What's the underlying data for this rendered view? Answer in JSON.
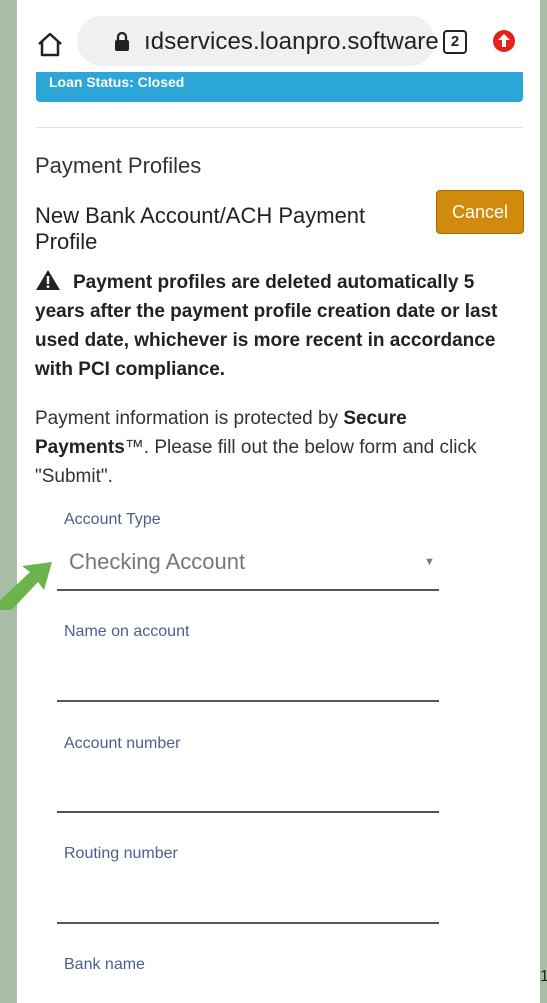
{
  "browser": {
    "url": "ıdservices.loanpro.software",
    "tab_count": "2"
  },
  "loan": {
    "status": "Loan Status: Closed"
  },
  "page": {
    "section_title": "Payment Profiles",
    "form_title": "New Bank Account/ACH Payment Profile",
    "cancel_label": "Cancel",
    "warning": "Payment profiles are deleted automatically 5 years after the payment profile creation date or last used date, whichever is more recent in accordance with PCI compliance.",
    "info_prefix": "Payment information is protected by ",
    "info_brand": "Secure Payments",
    "info_suffix": "™. Please fill out the below form and click \"Submit\"."
  },
  "form": {
    "account_type_label": "Account Type",
    "account_type_value": "Checking Account",
    "name_label": "Name on account",
    "account_number_label": "Account number",
    "routing_number_label": "Routing number",
    "bank_name_label": "Bank name"
  },
  "icons": {
    "home": "home-icon",
    "lock": "lock-icon",
    "tabs": "tab-switcher-icon",
    "update": "update-icon",
    "warning": "warning-icon",
    "dropdown": "chevron-down-icon"
  },
  "colors": {
    "status_bar": "#2ba6d6",
    "cancel_button": "#d18a0c",
    "field_label": "#4e5c90",
    "annotation_arrow": "#6bb34a"
  },
  "edge_text": "1"
}
